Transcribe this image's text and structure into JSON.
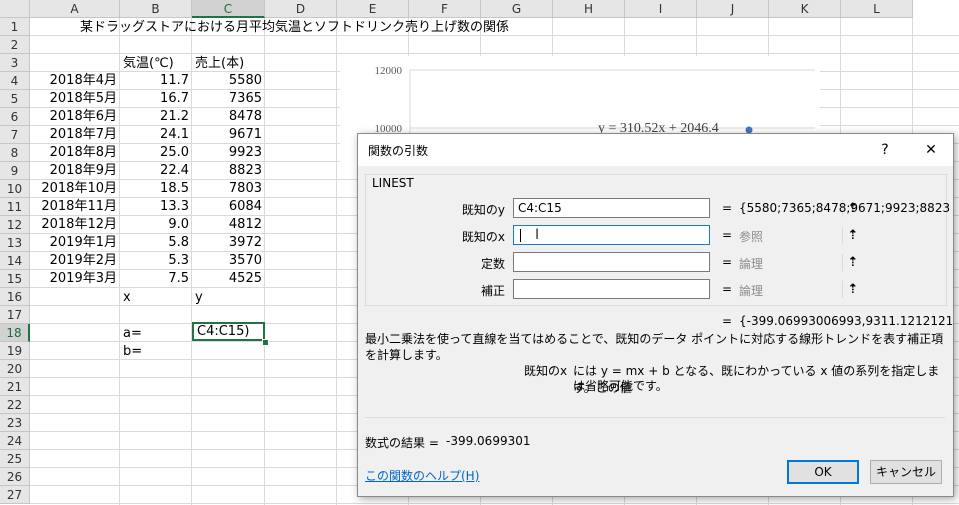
{
  "columns": [
    "A",
    "B",
    "C",
    "D",
    "E",
    "F",
    "G",
    "H",
    "I",
    "J",
    "K",
    "L"
  ],
  "rows": [
    "1",
    "2",
    "3",
    "4",
    "5",
    "6",
    "7",
    "8",
    "9",
    "10",
    "11",
    "12",
    "13",
    "14",
    "15",
    "16",
    "17",
    "18",
    "19",
    "20",
    "21",
    "22",
    "23",
    "24",
    "25",
    "26",
    "27"
  ],
  "sheet": {
    "title": "某ドラッグストアにおける月平均気温とソフトドリンク売り上げ数の関係",
    "header_temp": "気温(℃)",
    "header_sales": "売上(本)",
    "data": [
      {
        "month": "2018年4月",
        "temp": "11.7",
        "sales": "5580"
      },
      {
        "month": "2018年5月",
        "temp": "16.7",
        "sales": "7365"
      },
      {
        "month": "2018年6月",
        "temp": "21.2",
        "sales": "8478"
      },
      {
        "month": "2018年7月",
        "temp": "24.1",
        "sales": "9671"
      },
      {
        "month": "2018年8月",
        "temp": "25.0",
        "sales": "9923"
      },
      {
        "month": "2018年9月",
        "temp": "22.4",
        "sales": "8823"
      },
      {
        "month": "2018年10月",
        "temp": "18.5",
        "sales": "7803"
      },
      {
        "month": "2018年11月",
        "temp": "13.3",
        "sales": "6084"
      },
      {
        "month": "2018年12月",
        "temp": "9.0",
        "sales": "4812"
      },
      {
        "month": "2019年1月",
        "temp": "5.8",
        "sales": "3972"
      },
      {
        "month": "2019年2月",
        "temp": "5.3",
        "sales": "3570"
      },
      {
        "month": "2019年3月",
        "temp": "7.5",
        "sales": "4525"
      }
    ],
    "label_x": "x",
    "label_y": "y",
    "label_a": "a=",
    "label_b": "b=",
    "active_cell_text": "C4:C15)"
  },
  "chart": {
    "y_tick_top": "12000",
    "y_tick_2": "10000",
    "trendline_equation": "y = 310.52x + 2046.4",
    "point_color": "#4472c4"
  },
  "dialog": {
    "title": "関数の引数",
    "help_glyph": "?",
    "close_glyph": "✕",
    "function_name": "LINEST",
    "args": [
      {
        "label": "既知のy",
        "value": "C4:C15",
        "result": "{5580;7365;8478;9671;9923;8823",
        "result_gray": false
      },
      {
        "label": "既知のx",
        "value": "",
        "result": "参照",
        "result_gray": true
      },
      {
        "label": "定数",
        "value": "",
        "result": "論理",
        "result_gray": true
      },
      {
        "label": "補正",
        "value": "",
        "result": "論理",
        "result_gray": true
      }
    ],
    "equals": "=",
    "overall_result": "{-399.06993006993,9311.1212121",
    "description": "最小二乗法を使って直線を当てはめることで、既知のデータ ポイントに対応する線形トレンドを表す補正項を計算します。",
    "arg_help_name": "既知のx",
    "arg_help_text_1": "には y = mx + b となる、既にわかっている x 値の系列を指定します。この値",
    "arg_help_text_2": "は省略可能です。",
    "formula_result_label": "数式の結果 =",
    "formula_result_value": "-399.0699301",
    "help_link": "この関数のヘルプ(H)",
    "ok_label": "OK",
    "cancel_label": "キャンセル"
  }
}
